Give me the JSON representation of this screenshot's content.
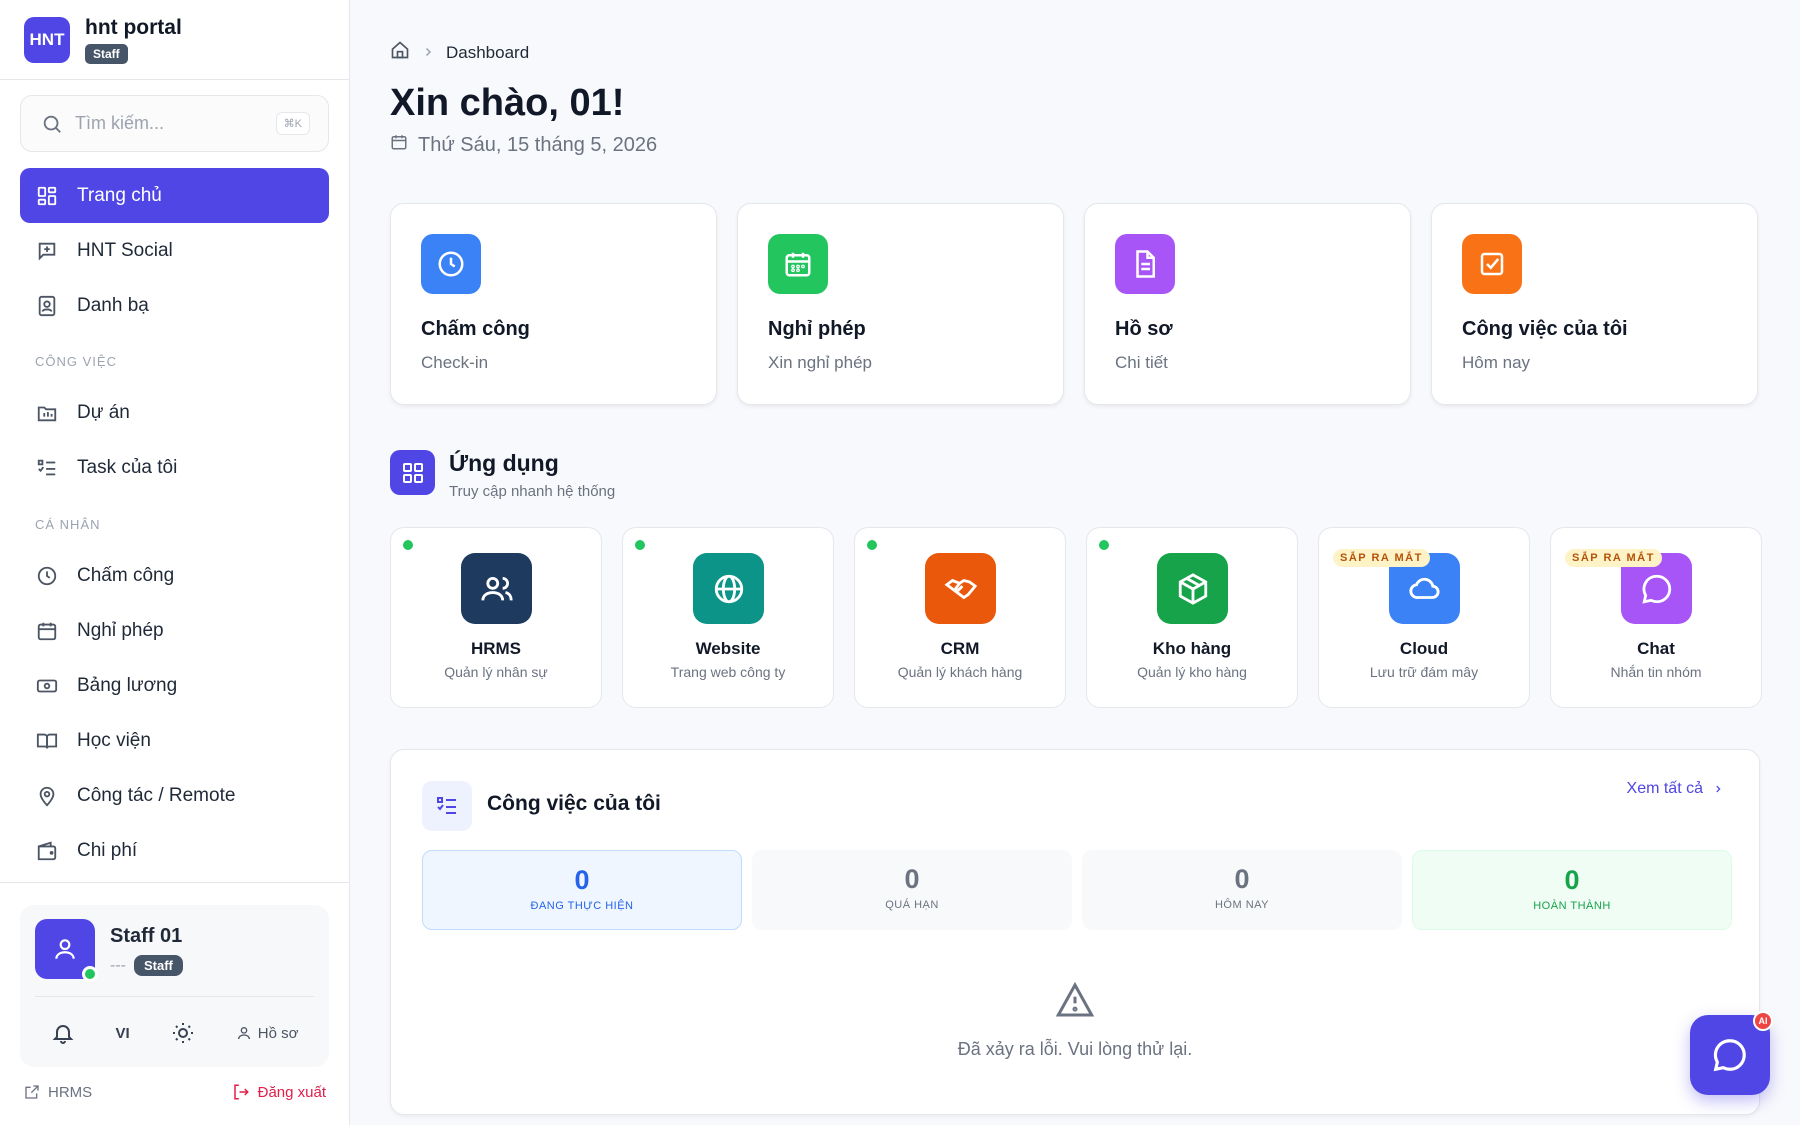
{
  "brand": {
    "logo": "HNT",
    "name": "hnt portal",
    "badge": "Staff"
  },
  "search": {
    "placeholder": "Tìm kiếm...",
    "shortcut": "⌘K"
  },
  "nav": {
    "main": [
      {
        "label": "Trang chủ",
        "icon": "grid-icon",
        "active": true
      },
      {
        "label": "HNT Social",
        "icon": "social-icon"
      },
      {
        "label": "Danh bạ",
        "icon": "contacts-icon"
      }
    ],
    "work_title": "CÔNG VIỆC",
    "work": [
      {
        "label": "Dự án",
        "icon": "folder-icon"
      },
      {
        "label": "Task của tôi",
        "icon": "task-list-icon"
      }
    ],
    "personal_title": "CÁ NHÂN",
    "personal": [
      {
        "label": "Chấm công",
        "icon": "clock-icon"
      },
      {
        "label": "Nghỉ phép",
        "icon": "calendar-icon"
      },
      {
        "label": "Bảng lương",
        "icon": "payroll-icon"
      },
      {
        "label": "Học viện",
        "icon": "book-icon"
      },
      {
        "label": "Công tác / Remote",
        "icon": "location-icon"
      },
      {
        "label": "Chi phí",
        "icon": "wallet-icon"
      }
    ]
  },
  "user": {
    "name": "Staff 01",
    "dash": "---",
    "role": "Staff",
    "lang": "VI",
    "profile": "Hồ sơ"
  },
  "footer": {
    "hrms": "HRMS",
    "logout": "Đăng xuất"
  },
  "breadcrumb": {
    "current": "Dashboard"
  },
  "greeting": "Xin chào, 01!",
  "date": "Thứ Sáu, 15 tháng 5, 2026",
  "quick_cards": [
    {
      "title": "Chấm công",
      "sub": "Check-in",
      "color": "#3b82f6",
      "icon": "clock-icon"
    },
    {
      "title": "Nghỉ phép",
      "sub": "Xin nghỉ phép",
      "color": "#22c55e",
      "icon": "calendar-icon"
    },
    {
      "title": "Hồ sơ",
      "sub": "Chi tiết",
      "color": "#a855f7",
      "icon": "document-icon"
    },
    {
      "title": "Công việc của tôi",
      "sub": "Hôm nay",
      "color": "#f97316",
      "icon": "checkbox-icon"
    }
  ],
  "apps_section": {
    "title": "Ứng dụng",
    "sub": "Truy cập nhanh hệ thống"
  },
  "apps": [
    {
      "name": "HRMS",
      "desc": "Quản lý nhân sự",
      "color": "#1e3a5f",
      "icon": "users-icon",
      "online": true
    },
    {
      "name": "Website",
      "desc": "Trang web công ty",
      "color": "#0d9488",
      "icon": "globe-icon",
      "online": true
    },
    {
      "name": "CRM",
      "desc": "Quản lý khách hàng",
      "color": "#ea580c",
      "icon": "handshake-icon",
      "online": true
    },
    {
      "name": "Kho hàng",
      "desc": "Quản lý kho hàng",
      "color": "#16a34a",
      "icon": "box-icon",
      "online": true
    },
    {
      "name": "Cloud",
      "desc": "Lưu trữ đám mây",
      "color": "#3b82f6",
      "icon": "cloud-icon",
      "badge": "SẮP RA MẮT"
    },
    {
      "name": "Chat",
      "desc": "Nhắn tin nhóm",
      "color": "#a855f7",
      "icon": "chat-icon",
      "badge": "SẮP RA MẮT"
    }
  ],
  "tasks": {
    "title": "Công việc của tôi",
    "see_all": "Xem tất cả",
    "stats": [
      {
        "value": "0",
        "label": "ĐANG THỰC HIỆN"
      },
      {
        "value": "0",
        "label": "QUÁ HẠN"
      },
      {
        "value": "0",
        "label": "HÔM NAY"
      },
      {
        "value": "0",
        "label": "HOÀN THÀNH"
      }
    ],
    "error": "Đã xảy ra lỗi. Vui lòng thử lại."
  },
  "chat_fab": {
    "badge": "AI"
  }
}
